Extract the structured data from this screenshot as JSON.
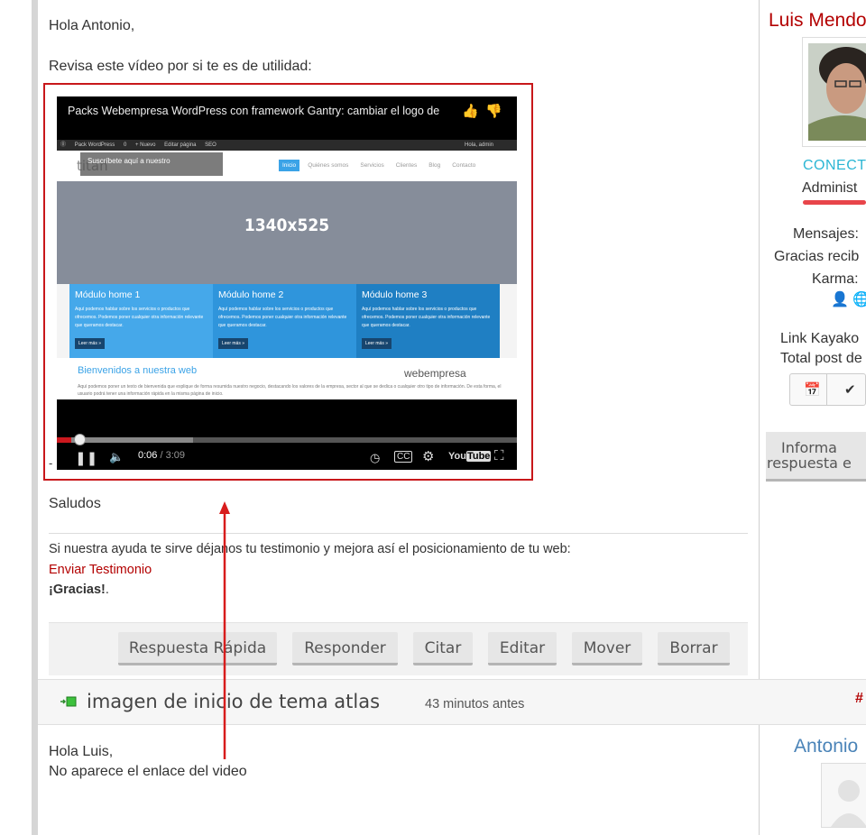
{
  "post1": {
    "greeting": "Hola Antonio,",
    "intro": "Revisa este vídeo por si te es de utilidad:",
    "dash": "-",
    "closing": "Saludos",
    "signature_text": "Si nuestra ayuda te sirve déjanos tu testimonio y mejora así el posicionamiento de tu web:",
    "signature_link": "Enviar Testimonio",
    "thanks": "¡Gracias!",
    "thanks_end": "."
  },
  "video": {
    "title": "Packs Webempresa WordPress con framework Gantry: cambiar el logo de",
    "subscribe": "Suscríbete aquí a nuestro",
    "wpbar": [
      "Pack WordPress",
      "0",
      "+ Nuevo",
      "Editar página",
      "SEO"
    ],
    "wpbar_right": "Hola, admin",
    "logo": "titan",
    "nav": [
      "Inicio",
      "Quiénes somos",
      "Servicios",
      "Clientes",
      "Blog",
      "Contacto"
    ],
    "hero_text": "1340x525",
    "modules": [
      {
        "title": "Módulo home 1",
        "text": "Aquí podemos hablar sobre los servicios o productos que ofrecemos. Podemos poner cualquier otra información relevante que queramos destacar.",
        "button": "Leer más »",
        "color": "#45a8ea"
      },
      {
        "title": "Módulo home 2",
        "text": "Aquí podemos hablar sobre los servicios o productos que ofrecemos. Podemos poner cualquier otra información relevante que queramos destacar.",
        "button": "Leer más »",
        "color": "#2f95dc"
      },
      {
        "title": "Módulo home 3",
        "text": "Aquí podemos hablar sobre los servicios o productos que ofrecemos. Podemos poner cualquier otra información relevante que queramos destacar.",
        "button": "Leer más »",
        "color": "#1f7fc3"
      }
    ],
    "welcome_title": "Bienvenidos a nuestra web",
    "welcome_text": "Aquí podemos poner un texto de bienvenida que explique de forma resumida nuestro negocio, destacando los valores de la empresa, sector al que se dedica o cualquier otro tipo de información. De esta forma, el usuario podrá tener una información rápida en la misma página de inicio.",
    "brand": "webempresa",
    "time_current": "0:06",
    "time_total": "/ 3:09",
    "progress": 0.032
  },
  "toolbar": {
    "buttons": [
      "Respuesta Rápida",
      "Responder",
      "Citar",
      "Editar",
      "Mover",
      "Borrar"
    ]
  },
  "post2": {
    "title": "imagen de inicio de tema atlas",
    "time": "43 minutos antes",
    "hash": "#",
    "greeting": "Hola Luis,",
    "body": "No aparece el enlace del video"
  },
  "author1": {
    "name": "Luis Mendo",
    "status": "CONECT",
    "role": "Administ",
    "messages_label": "Mensajes:",
    "thanks_label": "Gracias recib",
    "karma_label": "Karma:",
    "link_kayako": "Link Kayako",
    "total_post": "Total post de",
    "info_button_line1": "Informa",
    "info_button_line2": "respuesta e"
  },
  "author2": {
    "name": "Antonio"
  },
  "colors": {
    "accent_red": "#b30000",
    "highlight_border": "#c8171a",
    "status_cyan": "#2bb6d4",
    "author2_blue": "#4b84b8"
  }
}
